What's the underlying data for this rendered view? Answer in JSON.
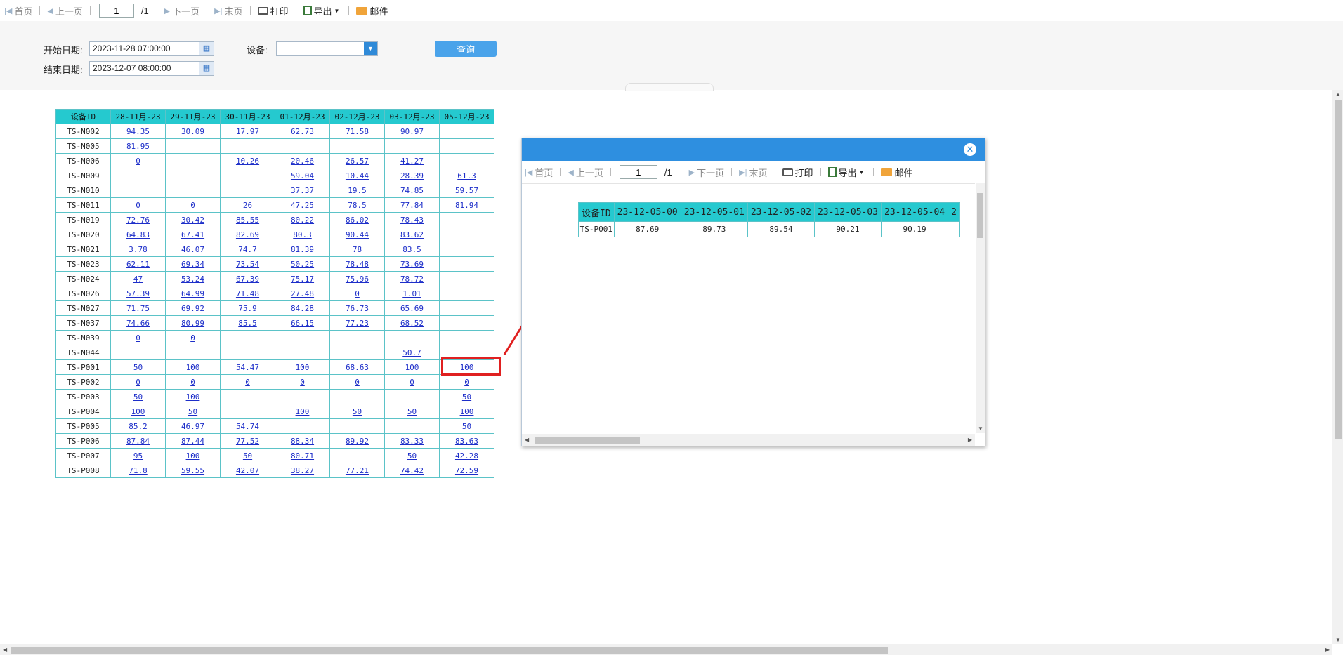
{
  "toolbar": {
    "first": "首页",
    "prev": "上一页",
    "page_value": "1",
    "page_total": "/1",
    "next": "下一页",
    "last": "末页",
    "print": "打印",
    "export": "导出",
    "mail": "邮件"
  },
  "filter": {
    "start_label": "开始日期:",
    "start_value": "2023-11-28 07:00:00",
    "end_label": "结束日期:",
    "end_value": "2023-12-07 08:00:00",
    "device_label": "设备:",
    "device_value": "",
    "query_label": "查询"
  },
  "main_table": {
    "headers": [
      "设备ID",
      "28-11月-23",
      "29-11月-23",
      "30-11月-23",
      "01-12月-23",
      "02-12月-23",
      "03-12月-23",
      "05-12月-23"
    ],
    "rows": [
      [
        "TS-N002",
        "94.35",
        "30.09",
        "17.97",
        "62.73",
        "71.58",
        "90.97",
        ""
      ],
      [
        "TS-N005",
        "81.95",
        "",
        "",
        "",
        "",
        "",
        ""
      ],
      [
        "TS-N006",
        "0",
        "",
        "10.26",
        "20.46",
        "26.57",
        "41.27",
        ""
      ],
      [
        "TS-N009",
        "",
        "",
        "",
        "59.04",
        "10.44",
        "28.39",
        "61.3"
      ],
      [
        "TS-N010",
        "",
        "",
        "",
        "37.37",
        "19.5",
        "74.85",
        "59.57"
      ],
      [
        "TS-N011",
        "0",
        "0",
        "26",
        "47.25",
        "78.5",
        "77.84",
        "81.94"
      ],
      [
        "TS-N019",
        "72.76",
        "30.42",
        "85.55",
        "80.22",
        "86.02",
        "78.43",
        ""
      ],
      [
        "TS-N020",
        "64.83",
        "67.41",
        "82.69",
        "80.3",
        "90.44",
        "83.62",
        ""
      ],
      [
        "TS-N021",
        "3.78",
        "46.07",
        "74.7",
        "81.39",
        "78",
        "83.5",
        ""
      ],
      [
        "TS-N023",
        "62.11",
        "69.34",
        "73.54",
        "50.25",
        "78.48",
        "73.69",
        ""
      ],
      [
        "TS-N024",
        "47",
        "53.24",
        "67.39",
        "75.17",
        "75.96",
        "78.72",
        ""
      ],
      [
        "TS-N026",
        "57.39",
        "64.99",
        "71.48",
        "27.48",
        "0",
        "1.01",
        ""
      ],
      [
        "TS-N027",
        "71.75",
        "69.92",
        "75.9",
        "84.28",
        "76.73",
        "65.69",
        ""
      ],
      [
        "TS-N037",
        "74.66",
        "80.99",
        "85.5",
        "66.15",
        "77.23",
        "68.52",
        ""
      ],
      [
        "TS-N039",
        "0",
        "0",
        "",
        "",
        "",
        "",
        ""
      ],
      [
        "TS-N044",
        "",
        "",
        "",
        "",
        "",
        "50.7",
        ""
      ],
      [
        "TS-P001",
        "50",
        "100",
        "54.47",
        "100",
        "68.63",
        "100",
        "100"
      ],
      [
        "TS-P002",
        "0",
        "0",
        "0",
        "0",
        "0",
        "0",
        "0"
      ],
      [
        "TS-P003",
        "50",
        "100",
        "",
        "",
        "",
        "",
        "50"
      ],
      [
        "TS-P004",
        "100",
        "50",
        "",
        "100",
        "50",
        "50",
        "100"
      ],
      [
        "TS-P005",
        "85.2",
        "46.97",
        "54.74",
        "",
        "",
        "",
        "50"
      ],
      [
        "TS-P006",
        "87.84",
        "87.44",
        "77.52",
        "88.34",
        "89.92",
        "83.33",
        "83.63"
      ],
      [
        "TS-P007",
        "95",
        "100",
        "50",
        "80.71",
        "",
        "50",
        "42.28"
      ],
      [
        "TS-P008",
        "71.8",
        "59.55",
        "42.07",
        "38.27",
        "77.21",
        "74.42",
        "72.59"
      ]
    ]
  },
  "popup": {
    "toolbar": {
      "first": "首页",
      "prev": "上一页",
      "page_value": "1",
      "page_total": "/1",
      "next": "下一页",
      "last": "末页",
      "print": "打印",
      "export": "导出",
      "mail": "邮件"
    },
    "table": {
      "headers": [
        "设备ID",
        "23-12-05-00",
        "23-12-05-01",
        "23-12-05-02",
        "23-12-05-03",
        "23-12-05-04",
        "2"
      ],
      "rows": [
        [
          "TS-P001",
          "87.69",
          "89.73",
          "89.54",
          "90.21",
          "90.19",
          ""
        ]
      ]
    }
  },
  "colors": {
    "header_bg": "#25c9cf",
    "link": "#1d2ec9",
    "popup_header": "#2e8fe0",
    "highlight": "#e02020",
    "query_button": "#4aa3ea"
  }
}
